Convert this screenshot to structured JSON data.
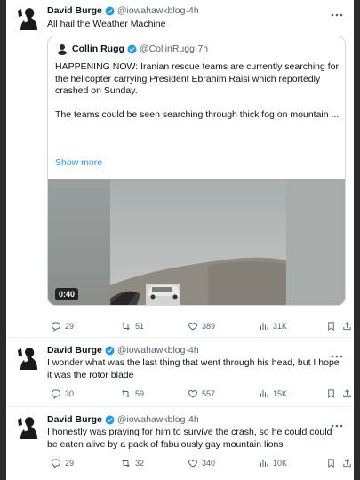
{
  "tweets": [
    {
      "name": "David Burge",
      "handle": "@iowahawkblog",
      "time": "4h",
      "text": "All hail the Weather Machine",
      "quote": {
        "name": "Collin Rugg",
        "handle": "@CollinRugg",
        "time": "7h",
        "text": "HAPPENING NOW: Iranian rescue teams are currently searching for the helicopter carrying President Ebrahim Raisi which reportedly crashed on Sunday.",
        "text2": "The teams could be seen searching through thick fog on mountain ...",
        "show_more": "Show more",
        "video_duration": "0:40"
      },
      "stats": {
        "replies": "29",
        "reposts": "51",
        "likes": "389",
        "views": "31K"
      }
    },
    {
      "name": "David Burge",
      "handle": "@iowahawkblog",
      "time": "4h",
      "text": "I wonder what was the last thing that went through his head, but I hope it was the rotor blade",
      "stats": {
        "replies": "30",
        "reposts": "59",
        "likes": "557",
        "views": "15K"
      }
    },
    {
      "name": "David Burge",
      "handle": "@iowahawkblog",
      "time": "4h",
      "text": "I honestly was praying for him to survive the crash, so he could could be eaten alive by a pack of fabulously gay mountain lions",
      "stats": {
        "replies": "29",
        "reposts": "32",
        "likes": "340",
        "views": "10K"
      }
    }
  ],
  "separator": " · ",
  "colors": {
    "accent": "#1d9bf0",
    "muted": "#536471",
    "border": "#cfd9de"
  },
  "icons": [
    "verified-badge-icon",
    "more-icon",
    "reply-icon",
    "repost-icon",
    "like-icon",
    "views-icon",
    "bookmark-icon",
    "share-icon"
  ]
}
